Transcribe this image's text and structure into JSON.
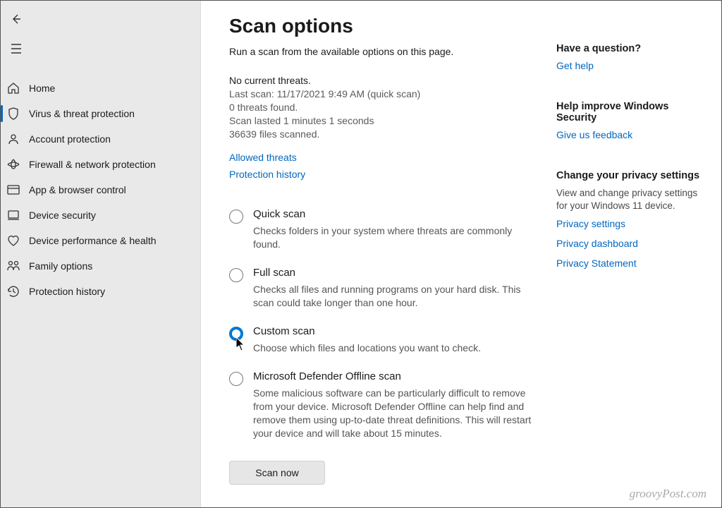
{
  "page": {
    "title": "Scan options",
    "subtitle": "Run a scan from the available options on this page."
  },
  "sidebar": {
    "items": [
      {
        "label": "Home",
        "icon": "home"
      },
      {
        "label": "Virus & threat protection",
        "icon": "shield",
        "active": true
      },
      {
        "label": "Account protection",
        "icon": "account"
      },
      {
        "label": "Firewall & network protection",
        "icon": "firewall"
      },
      {
        "label": "App & browser control",
        "icon": "app-browser"
      },
      {
        "label": "Device security",
        "icon": "device"
      },
      {
        "label": "Device performance & health",
        "icon": "heart"
      },
      {
        "label": "Family options",
        "icon": "family"
      },
      {
        "label": "Protection history",
        "icon": "history"
      }
    ]
  },
  "status": {
    "line1": "No current threats.",
    "line2": "Last scan: 11/17/2021 9:49 AM (quick scan)",
    "line3": "0 threats found.",
    "line4": "Scan lasted 1 minutes 1 seconds",
    "line5": "36639 files scanned."
  },
  "links": {
    "allowed": "Allowed threats",
    "history": "Protection history"
  },
  "options": [
    {
      "title": "Quick scan",
      "desc": "Checks folders in your system where threats are commonly found.",
      "selected": false
    },
    {
      "title": "Full scan",
      "desc": "Checks all files and running programs on your hard disk. This scan could take longer than one hour.",
      "selected": false
    },
    {
      "title": "Custom scan",
      "desc": "Choose which files and locations you want to check.",
      "selected": true
    },
    {
      "title": "Microsoft Defender Offline scan",
      "desc": "Some malicious software can be particularly difficult to remove from your device. Microsoft Defender Offline can help find and remove them using up-to-date threat definitions. This will restart your device and will take about 15 minutes.",
      "selected": false
    }
  ],
  "scan_button": "Scan now",
  "right": {
    "q_title": "Have a question?",
    "q_link": "Get help",
    "improve_title": "Help improve Windows Security",
    "improve_link": "Give us feedback",
    "privacy_title": "Change your privacy settings",
    "privacy_desc": "View and change privacy settings for your Windows 11 device.",
    "privacy_links": [
      "Privacy settings",
      "Privacy dashboard",
      "Privacy Statement"
    ]
  },
  "watermark": "groovyPost.com"
}
